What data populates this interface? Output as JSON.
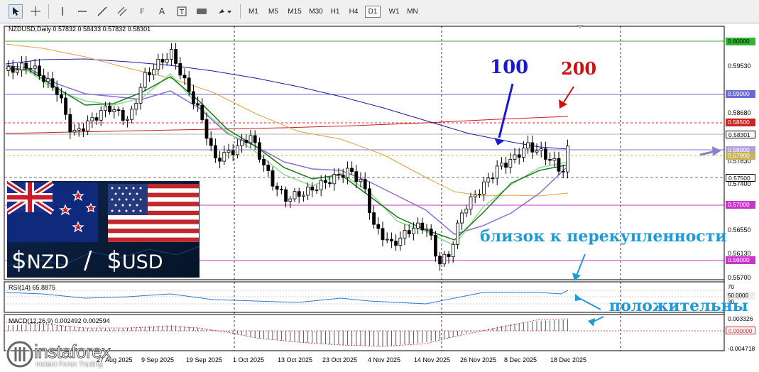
{
  "toolbar": {
    "drawing_tools": [
      "cursor-icon",
      "crosshair-icon",
      "vertical-line-icon",
      "horizontal-line-icon",
      "trendline-icon",
      "equidistant-channel-icon",
      "fibonacci-icon",
      "text-icon",
      "text-label-icon",
      "rectangle-icon",
      "shapes-menu-icon"
    ],
    "timeframes": [
      "M1",
      "M5",
      "M15",
      "M30",
      "H1",
      "H4",
      "D1",
      "W1",
      "MN"
    ],
    "active_timeframe": "D1"
  },
  "chart": {
    "symbol_line": "NZDUSD,Daily  0.57832 0.58433 0.57832 0.58301",
    "price_axis": [
      "0.59530",
      "0.58680",
      "0.57830",
      "0.57400",
      "0.56550",
      "0.56130",
      "0.55700"
    ],
    "price_tags": [
      {
        "text": "0.60000",
        "bg": "#2fb52f",
        "fg": "#000000"
      },
      {
        "text": "0.59000",
        "bg": "#6b6bd6",
        "fg": "#ffffff"
      },
      {
        "text": "0.58500",
        "bg": "#cc2222",
        "fg": "#ffffff"
      },
      {
        "text": "0.58301",
        "bg": "#ffffff",
        "fg": "#000000"
      },
      {
        "text": "0.58000",
        "bg": "#b29ed9",
        "fg": "#ffffff"
      },
      {
        "text": "0.57900",
        "bg": "#c8b25a",
        "fg": "#ffffff"
      },
      {
        "text": "0.57500",
        "bg": "#ffffff",
        "fg": "#000000"
      },
      {
        "text": "0.57000",
        "bg": "#cc33cc",
        "fg": "#ffffff"
      },
      {
        "text": "0.56000",
        "bg": "#cc33cc",
        "fg": "#ffffff"
      }
    ],
    "date_axis": [
      "27 Aug 2025",
      "9 Sep 2025",
      "19 Sep 2025",
      "1 Oct 2025",
      "13 Oct 2025",
      "23 Oct 2025",
      "4 Nov 2025",
      "14 Nov 2025",
      "26 Nov 2025",
      "8 Dec 2025",
      "18 Dec 2025"
    ]
  },
  "rsi": {
    "label": "RSI(14) 65.8875",
    "levels": [
      "70",
      "50.0000",
      "30"
    ]
  },
  "macd": {
    "label": "MACD(12,26,9) 0.002492 0.002594",
    "axis": [
      "0.003326",
      "0.000000",
      "-0.004718"
    ]
  },
  "annotations": {
    "ma100": "100",
    "ma200": "200",
    "overbought_note": "близок к перекупленности",
    "positive_note": "положительны"
  },
  "flag_panel": {
    "caption_left": "NZD",
    "caption_sep": "/",
    "caption_right": "USD",
    "currency_symbol": "$"
  },
  "logo": {
    "brand": "instaforex",
    "tagline": "Instant Forex Trading"
  },
  "colors": {
    "ma100": "#1a1aa0",
    "ma200": "#c81e1e",
    "ema_green_dark": "#1b7a1b",
    "ema_green_light": "#8fdc8f",
    "ema_purple": "#8c6fd0",
    "ema_orange": "#e0a040",
    "annot_cyan": "#1e9ad6",
    "annot_blue": "#1a1acc",
    "annot_red": "#cc1111"
  }
}
